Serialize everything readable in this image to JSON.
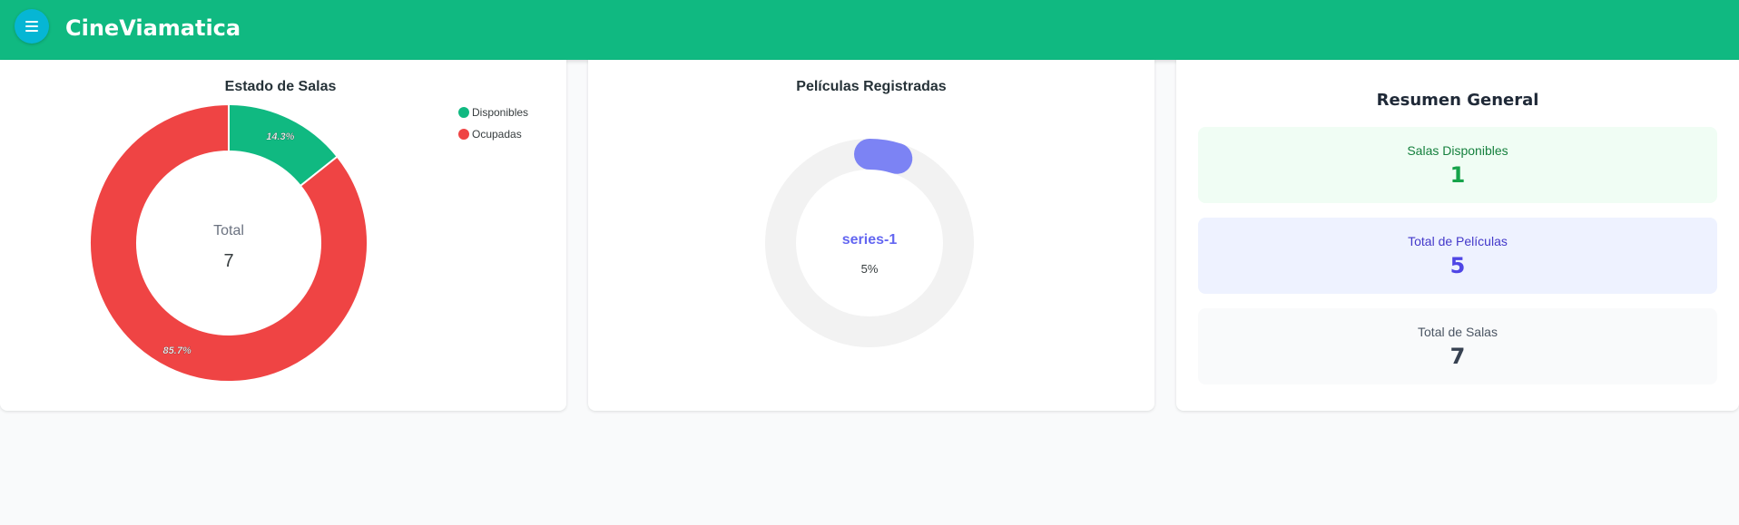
{
  "app": {
    "title": "CineViamatica"
  },
  "colors": {
    "brand": "#10b981",
    "menu_button": "#06b6d4",
    "available": "#10b981",
    "occupied": "#ef4444",
    "series": "#7c83f4"
  },
  "icons": {
    "menu": "hamburger-menu-icon"
  },
  "salas_card": {
    "total_label": "Total",
    "total_value": "7"
  },
  "peliculas_card": {
    "center_label": "series-1",
    "center_value": "5%"
  },
  "summary": {
    "title": "Resumen General",
    "stats": [
      {
        "label": "Salas Disponibles",
        "value": "1"
      },
      {
        "label": "Total de Películas",
        "value": "5"
      },
      {
        "label": "Total de Salas",
        "value": "7"
      }
    ]
  },
  "chart_data": [
    {
      "type": "pie",
      "title": "Estado de Salas",
      "categories": [
        "Disponibles",
        "Ocupadas"
      ],
      "values": [
        1,
        6
      ],
      "data_labels": [
        "14.3%",
        "85.7%"
      ],
      "legend_position": "top-right"
    },
    {
      "type": "radialBar",
      "title": "Películas Registradas",
      "series": [
        {
          "name": "series-1",
          "values": [
            5
          ]
        }
      ],
      "value_label": "5%"
    }
  ]
}
